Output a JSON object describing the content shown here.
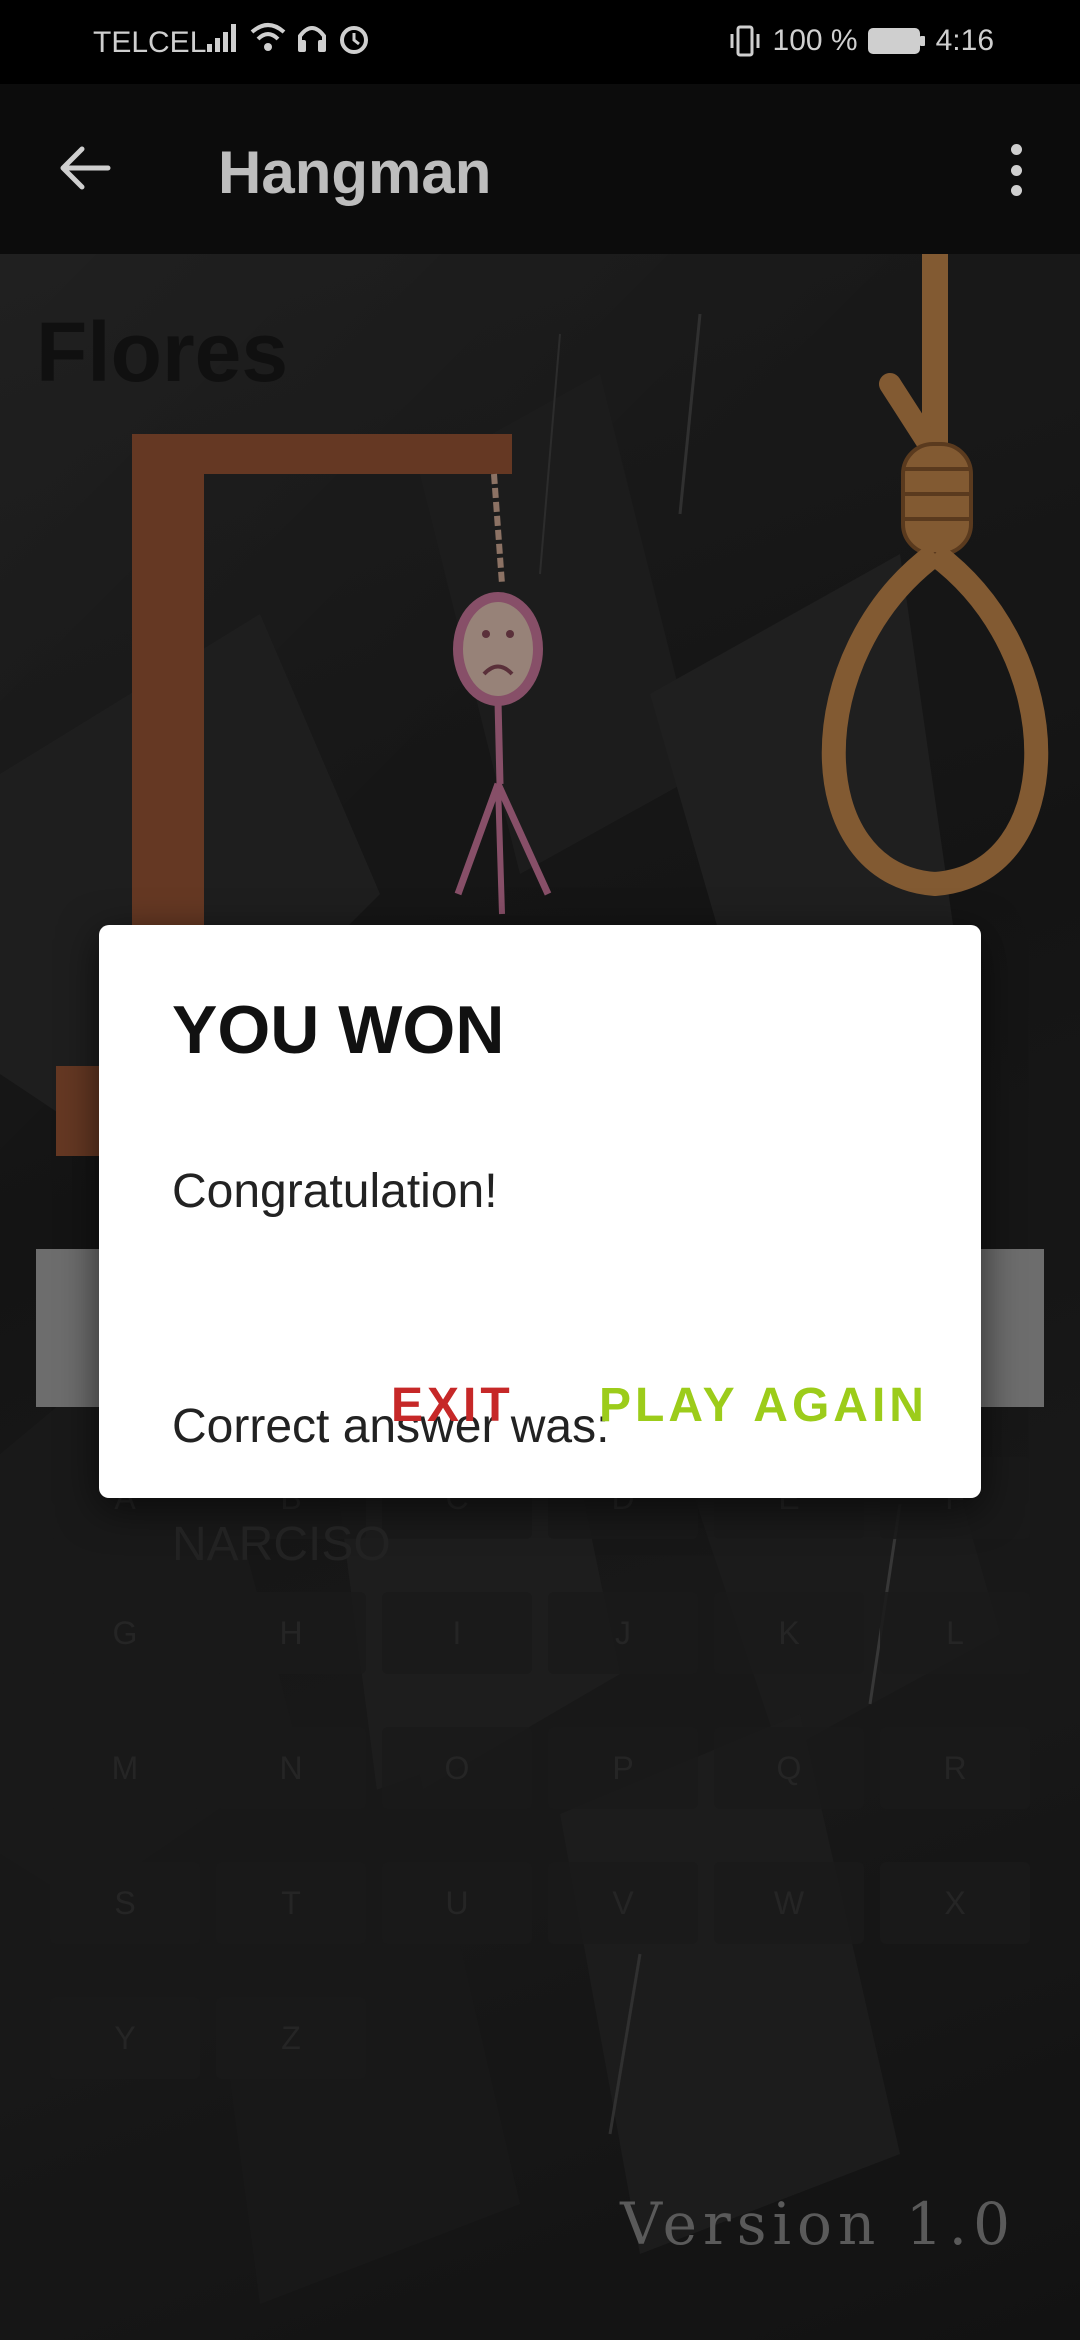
{
  "status_bar": {
    "carrier": "TELCEL",
    "battery_text": "100 %",
    "time": "4:16"
  },
  "app_bar": {
    "title": "Hangman"
  },
  "game": {
    "category": "Flores",
    "keys": [
      "A",
      "B",
      "C",
      "D",
      "E",
      "F",
      "G",
      "H",
      "I",
      "J",
      "K",
      "L",
      "M",
      "N",
      "O",
      "P",
      "Q",
      "R",
      "S",
      "T",
      "U",
      "V",
      "W",
      "X",
      "Y",
      "Z"
    ],
    "version": "Version 1.0"
  },
  "dialog": {
    "title": "YOU WON",
    "message_line1": "Congratulation!",
    "message_line2": "Correct answer was:",
    "answer": "NARCISO",
    "exit_label": "EXIT",
    "play_again_label": "PLAY AGAIN"
  },
  "colors": {
    "exit": "#c62828",
    "play_again": "#9ccc1a",
    "gallows": "#9b5637",
    "rope": "#c88a4e",
    "stick_figure": "#d07aa0"
  }
}
